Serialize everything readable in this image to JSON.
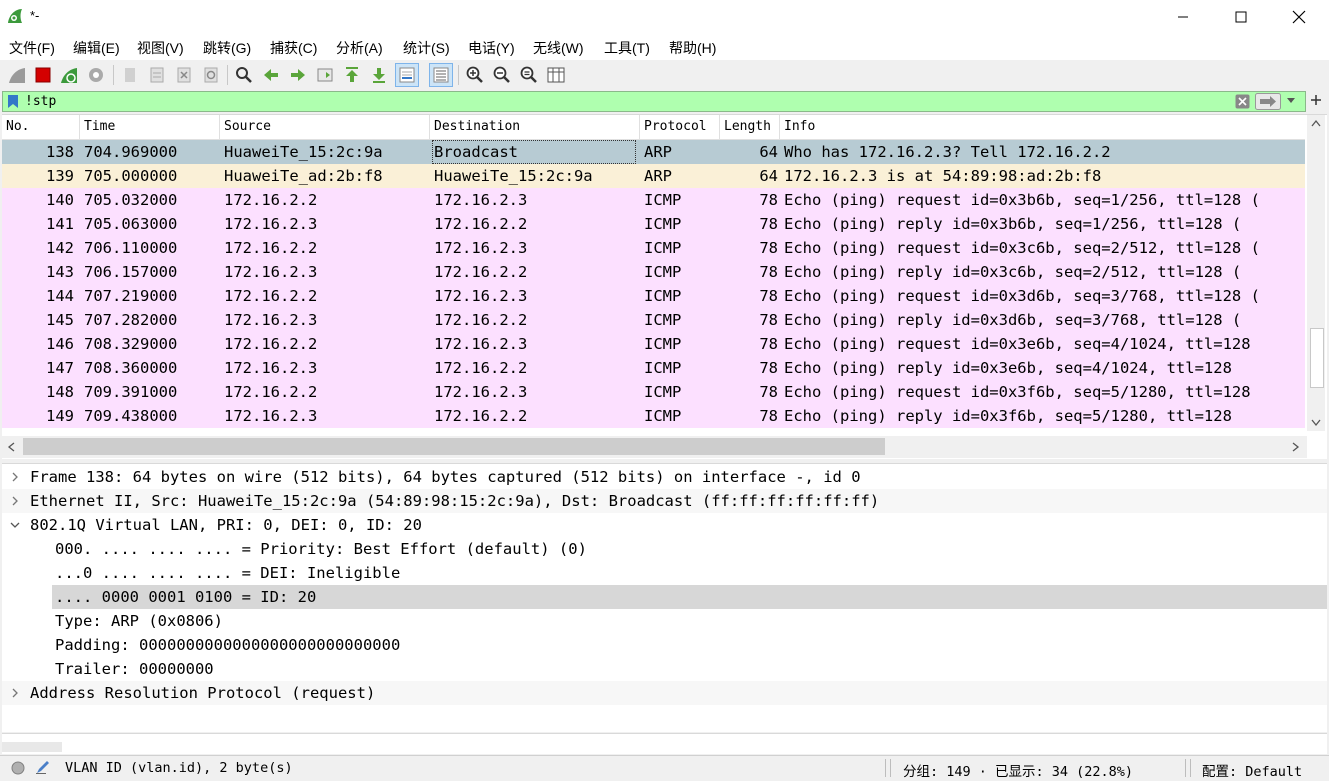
{
  "window": {
    "title": "*-"
  },
  "menu": [
    "文件(F)",
    "编辑(E)",
    "视图(V)",
    "跳转(G)",
    "捕获(C)",
    "分析(A)",
    "统计(S)",
    "电话(Y)",
    "无线(W)",
    "工具(T)",
    "帮助(H)"
  ],
  "filter": {
    "value": "!stp"
  },
  "columns": [
    "No.",
    "Time",
    "Source",
    "Destination",
    "Protocol",
    "Length",
    "Info"
  ],
  "packets": [
    {
      "no": "138",
      "time": "704.969000",
      "src": "HuaweiTe_15:2c:9a",
      "dst": "Broadcast",
      "proto": "ARP",
      "len": "64",
      "info": "Who has 172.16.2.3? Tell 172.16.2.2",
      "color": "#b7cbd3"
    },
    {
      "no": "139",
      "time": "705.000000",
      "src": "HuaweiTe_ad:2b:f8",
      "dst": "HuaweiTe_15:2c:9a",
      "proto": "ARP",
      "len": "64",
      "info": "172.16.2.3 is at 54:89:98:ad:2b:f8",
      "color": "#faf0d7"
    },
    {
      "no": "140",
      "time": "705.032000",
      "src": "172.16.2.2",
      "dst": "172.16.2.3",
      "proto": "ICMP",
      "len": "78",
      "info": "Echo (ping) request  id=0x3b6b, seq=1/256, ttl=128 (",
      "color": "#fce0ff"
    },
    {
      "no": "141",
      "time": "705.063000",
      "src": "172.16.2.3",
      "dst": "172.16.2.2",
      "proto": "ICMP",
      "len": "78",
      "info": "Echo (ping) reply    id=0x3b6b, seq=1/256, ttl=128 (",
      "color": "#fce0ff"
    },
    {
      "no": "142",
      "time": "706.110000",
      "src": "172.16.2.2",
      "dst": "172.16.2.3",
      "proto": "ICMP",
      "len": "78",
      "info": "Echo (ping) request  id=0x3c6b, seq=2/512, ttl=128 (",
      "color": "#fce0ff"
    },
    {
      "no": "143",
      "time": "706.157000",
      "src": "172.16.2.3",
      "dst": "172.16.2.2",
      "proto": "ICMP",
      "len": "78",
      "info": "Echo (ping) reply    id=0x3c6b, seq=2/512, ttl=128 (",
      "color": "#fce0ff"
    },
    {
      "no": "144",
      "time": "707.219000",
      "src": "172.16.2.2",
      "dst": "172.16.2.3",
      "proto": "ICMP",
      "len": "78",
      "info": "Echo (ping) request  id=0x3d6b, seq=3/768, ttl=128 (",
      "color": "#fce0ff"
    },
    {
      "no": "145",
      "time": "707.282000",
      "src": "172.16.2.3",
      "dst": "172.16.2.2",
      "proto": "ICMP",
      "len": "78",
      "info": "Echo (ping) reply    id=0x3d6b, seq=3/768, ttl=128 (",
      "color": "#fce0ff"
    },
    {
      "no": "146",
      "time": "708.329000",
      "src": "172.16.2.2",
      "dst": "172.16.2.3",
      "proto": "ICMP",
      "len": "78",
      "info": "Echo (ping) request  id=0x3e6b, seq=4/1024, ttl=128",
      "color": "#fce0ff"
    },
    {
      "no": "147",
      "time": "708.360000",
      "src": "172.16.2.3",
      "dst": "172.16.2.2",
      "proto": "ICMP",
      "len": "78",
      "info": "Echo (ping) reply    id=0x3e6b, seq=4/1024, ttl=128",
      "color": "#fce0ff"
    },
    {
      "no": "148",
      "time": "709.391000",
      "src": "172.16.2.2",
      "dst": "172.16.2.3",
      "proto": "ICMP",
      "len": "78",
      "info": "Echo (ping) request  id=0x3f6b, seq=5/1280, ttl=128",
      "color": "#fce0ff"
    },
    {
      "no": "149",
      "time": "709.438000",
      "src": "172.16.2.3",
      "dst": "172.16.2.2",
      "proto": "ICMP",
      "len": "78",
      "info": "Echo (ping) reply    id=0x3f6b, seq=5/1280, ttl=128",
      "color": "#fce0ff"
    }
  ],
  "details": [
    {
      "text": "Frame 138: 64 bytes on wire (512 bits), 64 bytes captured (512 bits) on interface -, id 0",
      "level": 0,
      "expanded": false
    },
    {
      "text": "Ethernet II, Src: HuaweiTe_15:2c:9a (54:89:98:15:2c:9a), Dst: Broadcast (ff:ff:ff:ff:ff:ff)",
      "level": 0,
      "expanded": false
    },
    {
      "text": "802.1Q Virtual LAN, PRI: 0, DEI: 0, ID: 20",
      "level": 0,
      "expanded": true
    },
    {
      "text": "000. .... .... .... = Priority: Best Effort (default) (0)",
      "level": 1
    },
    {
      "text": "...0 .... .... .... = DEI: Ineligible",
      "level": 1
    },
    {
      "text": ".... 0000 0001 0100 = ID: 20",
      "level": 1,
      "selected": true
    },
    {
      "text": "Type: ARP (0x0806)",
      "level": 1
    },
    {
      "text": "Padding: 0000000000000000000000000000",
      "level": 1
    },
    {
      "text": "Trailer: 00000000",
      "level": 1
    },
    {
      "text": "Address Resolution Protocol (request)",
      "level": 0,
      "expanded": false
    }
  ],
  "status": {
    "field_info": "VLAN ID (vlan.id), 2 byte(s)",
    "packets": "分组: 149 · 已显示: 34 (22.8%)",
    "profile": "配置: Default"
  }
}
